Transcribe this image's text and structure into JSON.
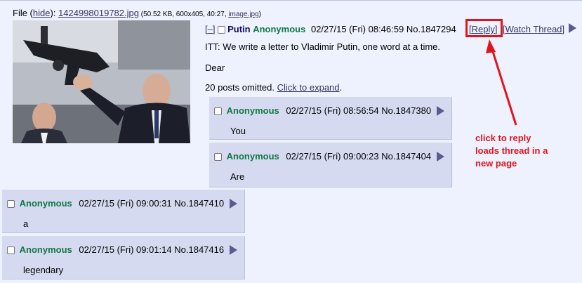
{
  "file": {
    "prefix": "File (",
    "hide_label": "hide",
    "after_hide": "): ",
    "filename": "1424998019782.jpg",
    "meta": " (50.52 KB, 600x405, 40:27, ",
    "image_link": "image.jpg",
    "meta_end": ")"
  },
  "op": {
    "collapse_label": "[–]",
    "subject": "Putin",
    "name": "Anonymous",
    "datetime": "02/27/15 (Fri) 08:46:59",
    "number": "No.1847294",
    "reply_label": "[Reply]",
    "watch_label": "[Watch Thread]",
    "message_line1": "ITT: We write a letter to Vladimir Putin, one word at a time.",
    "message_line2": "Dear",
    "omitted_text": "20 posts omitted. ",
    "expand_label": "Click to expand",
    "expand_end": "."
  },
  "replies": [
    {
      "name": "Anonymous",
      "datetime": "02/27/15 (Fri) 08:56:54",
      "number": "No.1847380",
      "message": "You"
    },
    {
      "name": "Anonymous",
      "datetime": "02/27/15 (Fri) 09:00:23",
      "number": "No.1847404",
      "message": "Are"
    },
    {
      "name": "Anonymous",
      "datetime": "02/27/15 (Fri) 09:00:31",
      "number": "No.1847410",
      "message": "a"
    },
    {
      "name": "Anonymous",
      "datetime": "02/27/15 (Fri) 09:01:14",
      "number": "No.1847416",
      "message": "legendary"
    }
  ],
  "annotation": {
    "line1": "click to reply",
    "line2": "loads thread in a",
    "line3": "new page",
    "color": "#e3131a"
  },
  "colors": {
    "background": "#eef2ff",
    "reply_bg": "#d6daf0",
    "name": "#117743",
    "subject": "#0f0c5d",
    "link": "#34345c"
  }
}
